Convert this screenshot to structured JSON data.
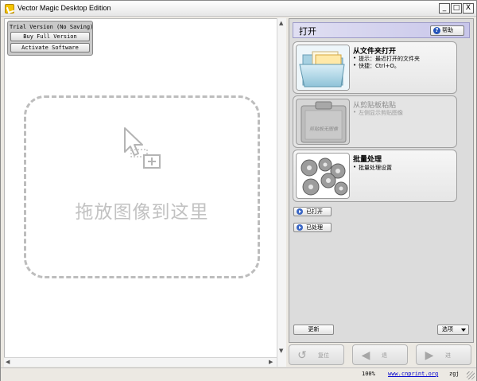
{
  "window": {
    "title": "Vector Magic Desktop Edition",
    "controls": [
      "_",
      "□",
      "X"
    ]
  },
  "trial": {
    "title": "Trial Version (No Saving)",
    "buy_label": "Buy Full Version",
    "activate_label": "Activate Software"
  },
  "canvas": {
    "drop_text": "拖放图像到这里"
  },
  "panel": {
    "title": "打开",
    "help_label": "帮助",
    "cards": [
      {
        "title": "从文件夹打开",
        "lines": [
          "提示：最近打开的文件夹",
          "快捷：Ctrl+O。"
        ],
        "enabled": true
      },
      {
        "title": "从剪贴板粘贴",
        "lines": [
          "左侧显示剪贴图像"
        ],
        "thumb_text": "剪贴板无图像",
        "enabled": false
      },
      {
        "title": "批量处理",
        "lines": [
          "批量处理设置"
        ],
        "enabled": true
      }
    ],
    "opened_label": "已打开",
    "processed_label": "已处理",
    "update_label": "更新",
    "options_label": "选项"
  },
  "nav": {
    "reset_label": "复位",
    "prev_label": "退",
    "next_label": "进"
  },
  "status": {
    "zoom": "100%",
    "link": "www.cnprint.org",
    "user": "zgj"
  },
  "colors": {
    "header_accent": "#c8c6ea",
    "link": "#0000cc",
    "help_icon": "#2453b8"
  }
}
